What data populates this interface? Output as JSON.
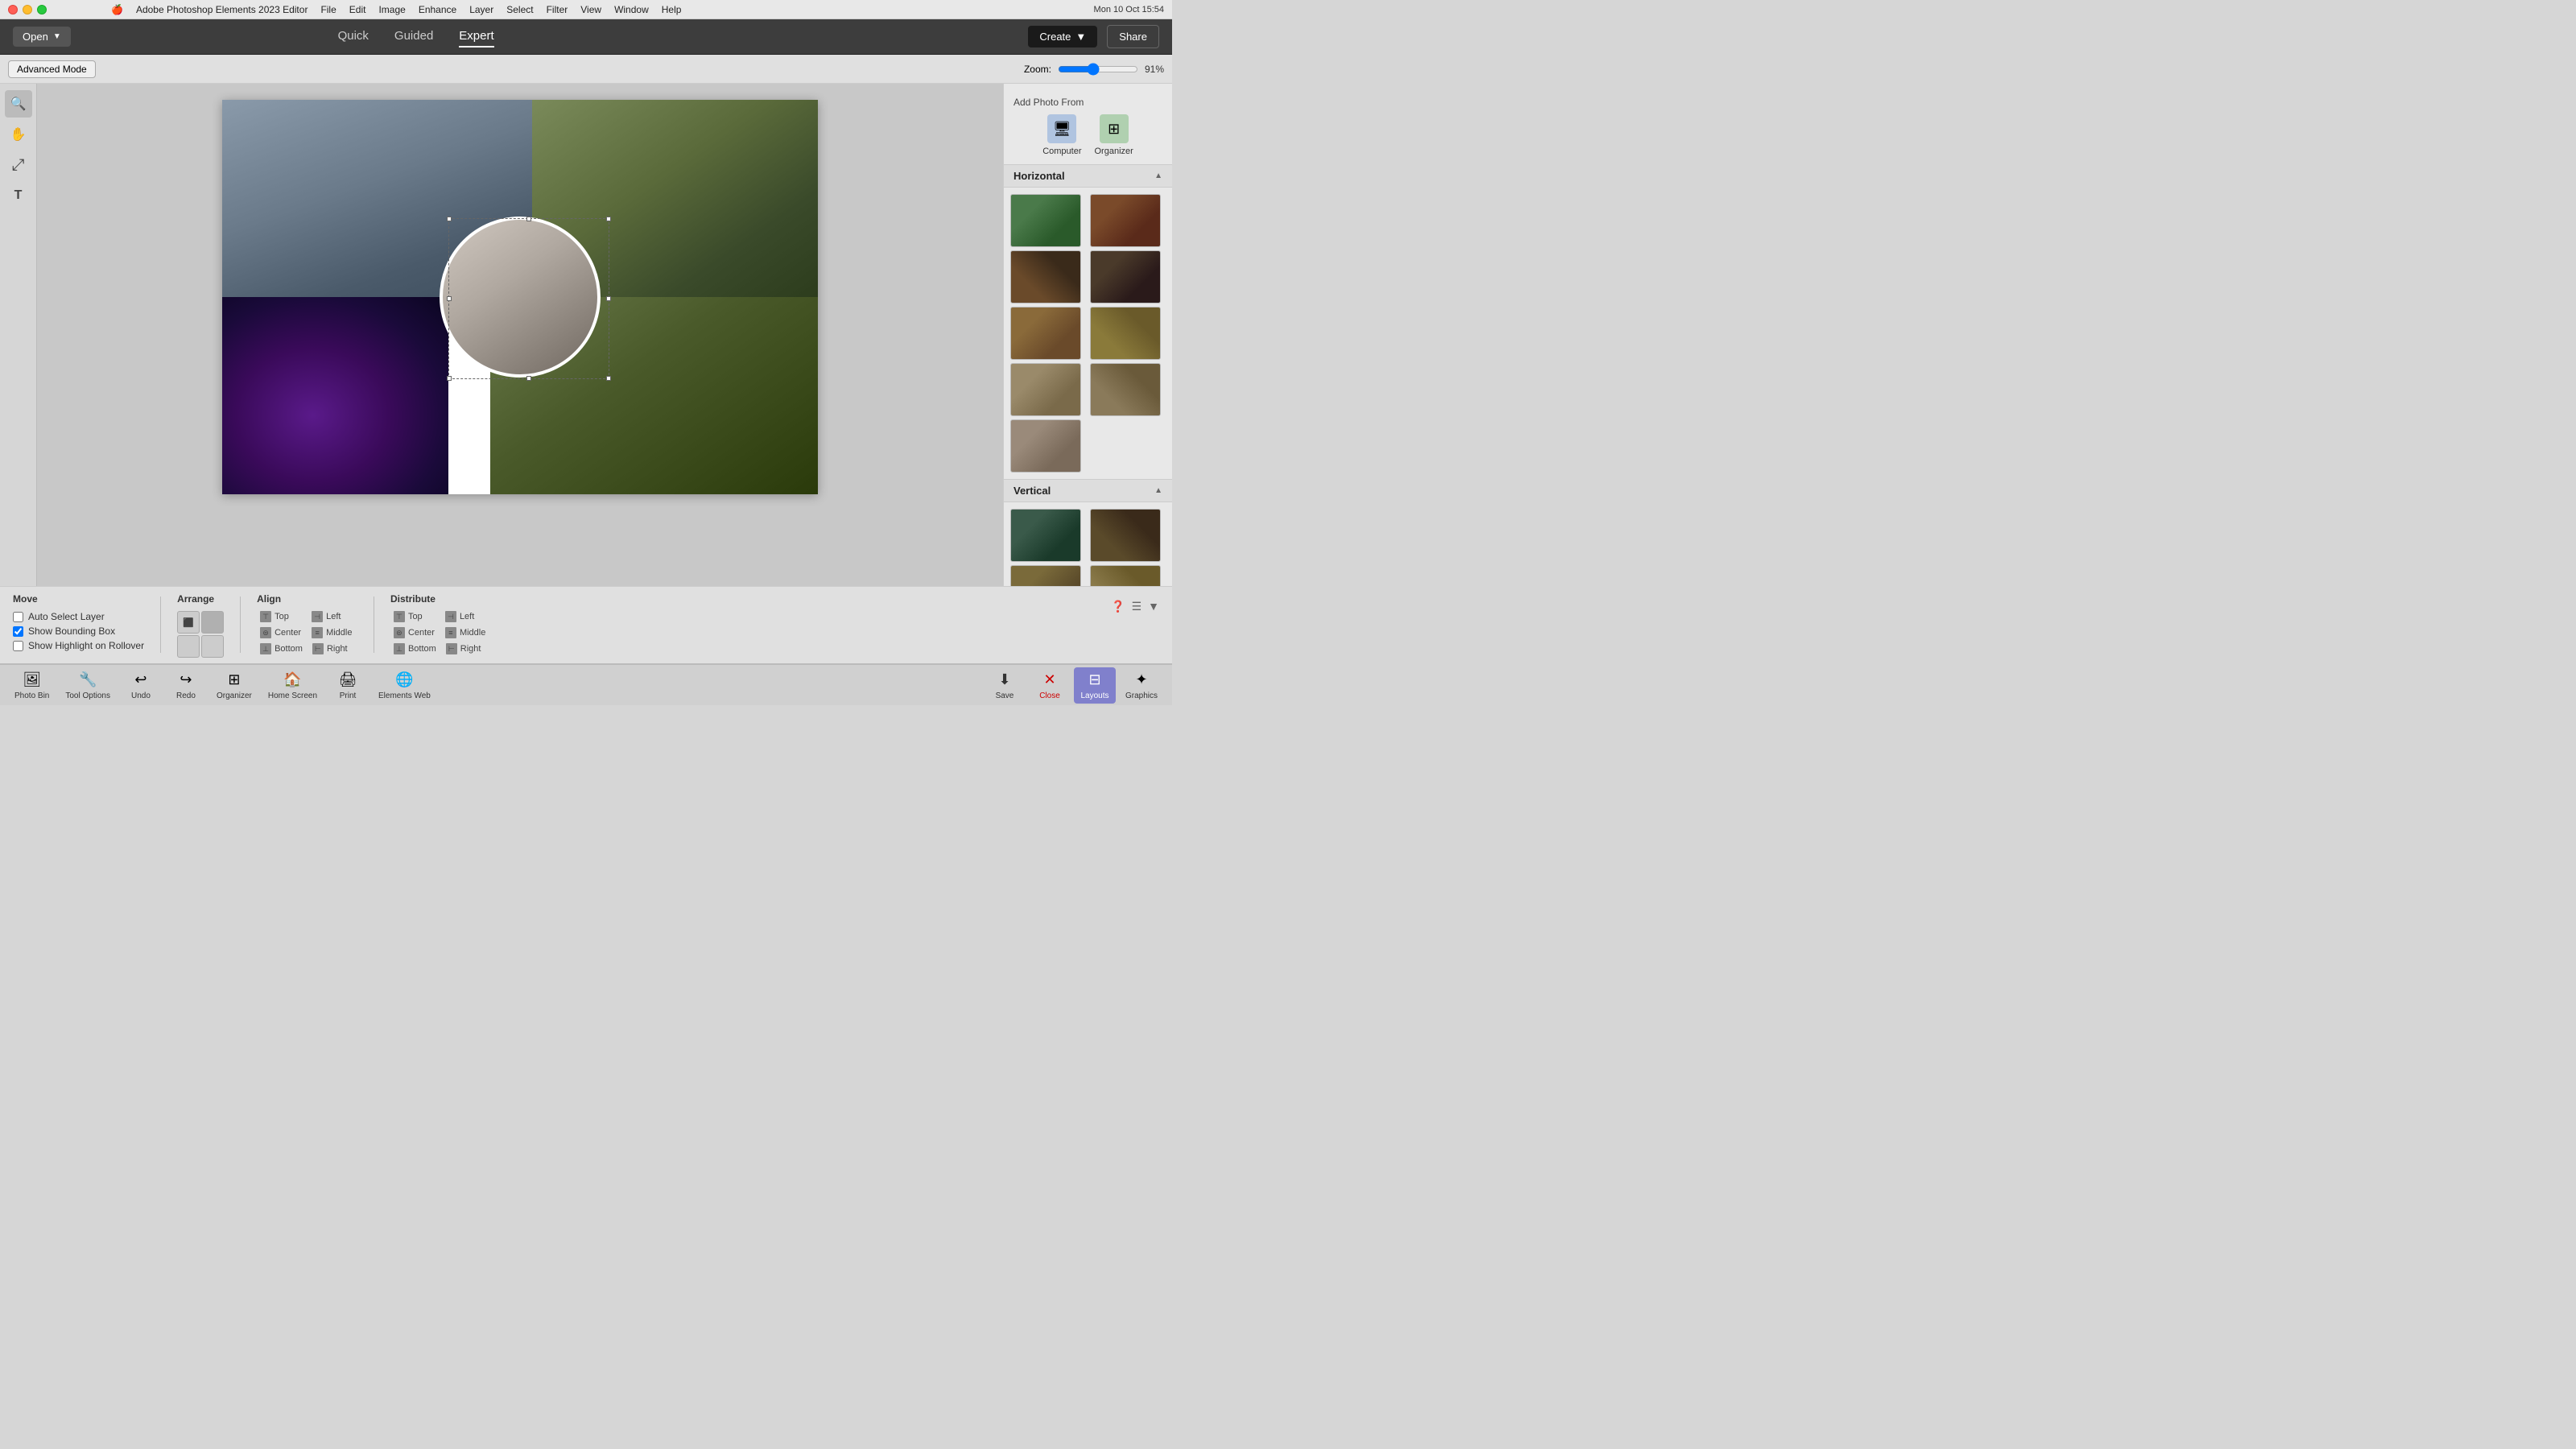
{
  "titleBar": {
    "appName": "Adobe Photoshop Elements 2023 Editor",
    "menus": [
      "File",
      "Edit",
      "Image",
      "Enhance",
      "Layer",
      "Select",
      "Filter",
      "View",
      "Window",
      "Help"
    ],
    "time": "Mon 10 Oct  15:54"
  },
  "header": {
    "openLabel": "Open",
    "tabs": [
      {
        "id": "quick",
        "label": "Quick",
        "active": false
      },
      {
        "id": "guided",
        "label": "Guided",
        "active": false
      },
      {
        "id": "expert",
        "label": "Expert",
        "active": true
      }
    ],
    "createLabel": "Create",
    "shareLabel": "Share"
  },
  "toolbar": {
    "advancedModeLabel": "Advanced Mode",
    "zoomLabel": "Zoom:",
    "zoomValue": 91,
    "zoomPercent": "91%"
  },
  "tools": [
    {
      "id": "search",
      "icon": "🔍",
      "label": "search"
    },
    {
      "id": "hand",
      "icon": "✋",
      "label": "hand"
    },
    {
      "id": "move",
      "icon": "✥",
      "label": "move"
    },
    {
      "id": "text",
      "icon": "T",
      "label": "text"
    }
  ],
  "rightPanel": {
    "addPhotoFrom": {
      "title": "Add Photo From",
      "computer": {
        "label": "Computer",
        "icon": "🖥"
      },
      "organizer": {
        "label": "Organizer",
        "icon": "⊞"
      }
    },
    "horizontal": {
      "label": "Horizontal",
      "layouts": [
        {
          "id": "h1",
          "class": "lt-1"
        },
        {
          "id": "h2",
          "class": "lt-2"
        },
        {
          "id": "h3",
          "class": "lt-3"
        },
        {
          "id": "h4",
          "class": "lt-4"
        },
        {
          "id": "h5",
          "class": "lt-5"
        },
        {
          "id": "h6",
          "class": "lt-6"
        },
        {
          "id": "h7",
          "class": "lt-7"
        },
        {
          "id": "h8",
          "class": "lt-8"
        },
        {
          "id": "h9",
          "class": "lt-9"
        }
      ]
    },
    "vertical": {
      "label": "Vertical",
      "layouts": [
        {
          "id": "v1",
          "class": "lt-v1"
        },
        {
          "id": "v2",
          "class": "lt-v2"
        },
        {
          "id": "v3",
          "class": "lt-v3"
        },
        {
          "id": "v4",
          "class": "lt-v4"
        },
        {
          "id": "v5",
          "class": "lt-v5"
        }
      ]
    }
  },
  "optionsBar": {
    "moveLabel": "Move",
    "autoSelectLayer": {
      "label": "Auto Select Layer",
      "checked": false
    },
    "showBoundingBox": {
      "label": "Show Bounding Box",
      "checked": true
    },
    "showHighlightOnRollover": {
      "label": "Show Highlight on Rollover",
      "checked": false
    },
    "arrangeLabel": "Arrange",
    "alignLabel": "Align",
    "distributeLabel": "Distribute",
    "alignItems": {
      "top": "Top",
      "center": "Center",
      "bottom": "Bottom",
      "left": "Left",
      "middle": "Middle",
      "right": "Right"
    },
    "distributeItems": {
      "top": "Top",
      "center": "Center",
      "bottom": "Bottom",
      "left": "Left",
      "middle": "Middle",
      "right": "Right"
    }
  },
  "taskbar": {
    "photoBin": "Photo Bin",
    "toolOptions": "Tool Options",
    "undo": "Undo",
    "redo": "Redo",
    "organizer": "Organizer",
    "homeScreen": "Home Screen",
    "print": "Print",
    "elementsWeb": "Elements Web",
    "save": "Save",
    "close": "Close",
    "layouts": "Layouts",
    "graphics": "Graphics"
  }
}
